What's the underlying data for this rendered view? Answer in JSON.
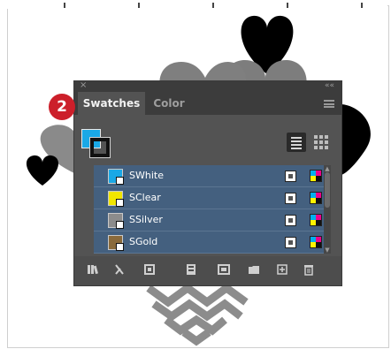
{
  "panel": {
    "tabs": [
      {
        "label": "Swatches",
        "active": true
      },
      {
        "label": "Color",
        "active": false
      }
    ],
    "close_glyph": "×",
    "collapse_glyph": "««",
    "step_badge": "2",
    "fill_color": "#1aa8e6",
    "stroke_color": "#111111",
    "swatches": [
      {
        "name": "SWhite",
        "color": "#1aa8e6"
      },
      {
        "name": "SClear",
        "color": "#f2e600"
      },
      {
        "name": "SSilver",
        "color": "#8c8c8c"
      },
      {
        "name": "SGold",
        "color": "#8a6a3b"
      }
    ],
    "bottom_tools": [
      "swatch-libraries-menu-icon",
      "add-selected-swatches-icon",
      "show-swatch-kinds-icon",
      "swatch-options-icon",
      "new-color-group-icon",
      "new-folder-icon",
      "new-swatch-icon",
      "delete-swatch-icon"
    ]
  },
  "colors": {
    "panel_bg": "#535353",
    "tab_bar": "#3c3c3c",
    "selection": "#44607f",
    "accent_red": "#cc1f2a",
    "heart_black": "#000000",
    "heart_gray": "#808080"
  }
}
